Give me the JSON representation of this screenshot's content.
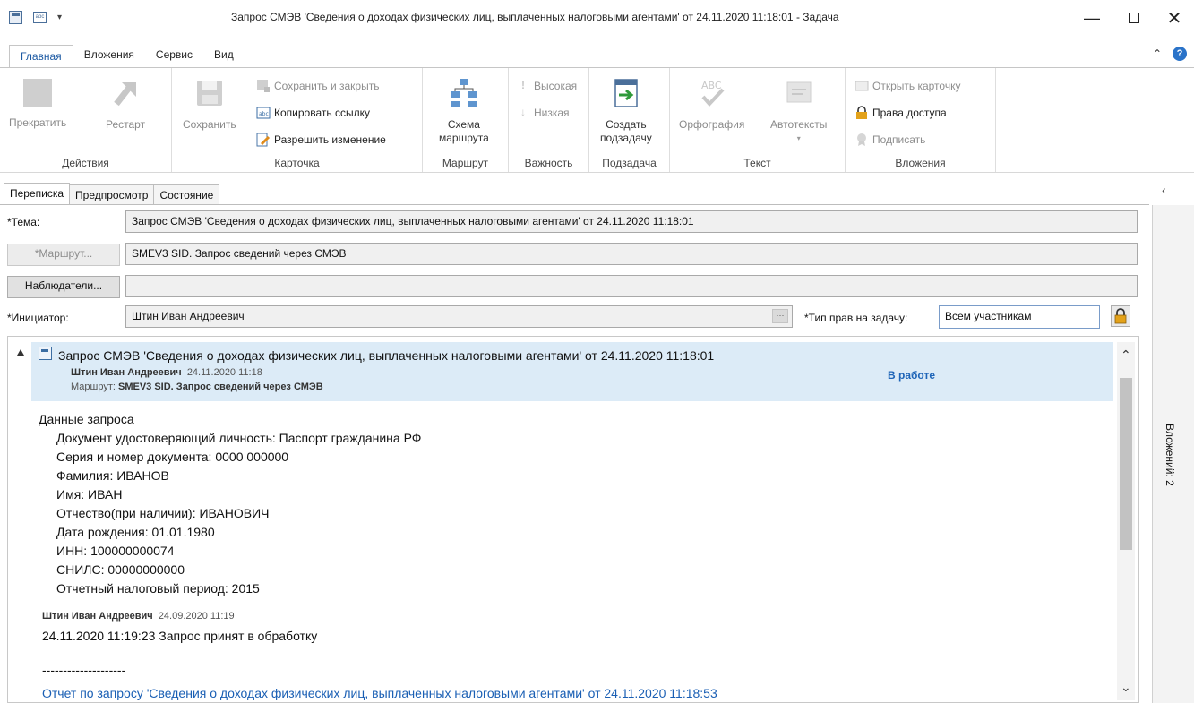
{
  "window": {
    "title": "Запрос СМЭВ 'Сведения о доходах физических лиц, выплаченных налоговыми агентами' от 24.11.2020 11:18:01 - Задача",
    "minimize_icon": "minimize-icon",
    "maximize_icon": "maximize-icon",
    "close_icon": "close-icon"
  },
  "ribbon_tabs": [
    "Главная",
    "Вложения",
    "Сервис",
    "Вид"
  ],
  "ribbon": {
    "actions": {
      "label": "Действия",
      "stop": "Прекратить",
      "restart": "Рестарт"
    },
    "card": {
      "label": "Карточка",
      "save": "Сохранить",
      "save_close": "Сохранить и закрыть",
      "copy_link": "Копировать ссылку",
      "allow_change": "Разрешить изменение"
    },
    "route": {
      "label": "Маршрут",
      "scheme_line1": "Схема",
      "scheme_line2": "маршрута"
    },
    "importance": {
      "label": "Важность",
      "high": "Высокая",
      "low": "Низкая"
    },
    "subtask": {
      "label": "Подзадача",
      "create_line1": "Создать",
      "create_line2": "подзадачу"
    },
    "text": {
      "label": "Текст",
      "spelling": "Орфография",
      "autotext": "Автотексты"
    },
    "attachments": {
      "label": "Вложения",
      "open_card": "Открыть карточку",
      "access_rights": "Права доступа",
      "sign": "Подписать"
    }
  },
  "form_tabs": [
    "Переписка",
    "Предпросмотр",
    "Состояние"
  ],
  "form": {
    "subject_label": "*Тема:",
    "subject_value": "Запрос СМЭВ 'Сведения о доходах физических лиц, выплаченных налоговыми агентами' от 24.11.2020 11:18:01",
    "route_button": "*Маршрут...",
    "route_value": "SMEV3 SID. Запрос сведений через СМЭВ",
    "observers_button": "Наблюдатели...",
    "observers_value": "",
    "initiator_label": "*Инициатор:",
    "initiator_value": "Штин Иван Андреевич",
    "ellipsis": "···",
    "rights_type_label": "*Тип прав на задачу:",
    "rights_type_value": "Всем участникам"
  },
  "correspondence": {
    "header_title": "Запрос СМЭВ 'Сведения о доходах физических лиц, выплаченных налоговыми агентами' от 24.11.2020 11:18:01",
    "author": "Штин Иван Андреевич",
    "author_date": "24.11.2020 11:18",
    "route_prefix": "Маршрут:",
    "route_name": "SMEV3 SID. Запрос сведений через СМЭВ",
    "status": "В работе",
    "body_title": "Данные запроса",
    "body_lines": [
      "Документ удостоверяющий личность: Паспорт гражданина РФ",
      "Серия и номер документа: 0000 000000",
      "Фамилия: ИВАНОВ",
      "Имя: ИВАН",
      "Отчество(при наличии): ИВАНОВИЧ",
      "Дата рождения: 01.01.1980",
      "ИНН: 100000000074",
      "СНИЛС: 00000000000",
      "Отчетный налоговый период: 2015"
    ],
    "comment_author": "Штин Иван Андреевич",
    "comment_date": "24.09.2020 11:19",
    "comment_text": "24.11.2020 11:19:23 Запрос принят в обработку",
    "separator": "--------------------",
    "report_link": "Отчет по запросу 'Сведения о доходах физических лиц, выплаченных налоговыми агентами' от 24.11.2020 11:18:53"
  },
  "side_panel": {
    "attachments": "Вложений: 2"
  },
  "colors": {
    "accent": "#1d5aa3",
    "header_bg": "#dcebf7",
    "status": "#1f65b8",
    "link": "#1a5fb4"
  }
}
